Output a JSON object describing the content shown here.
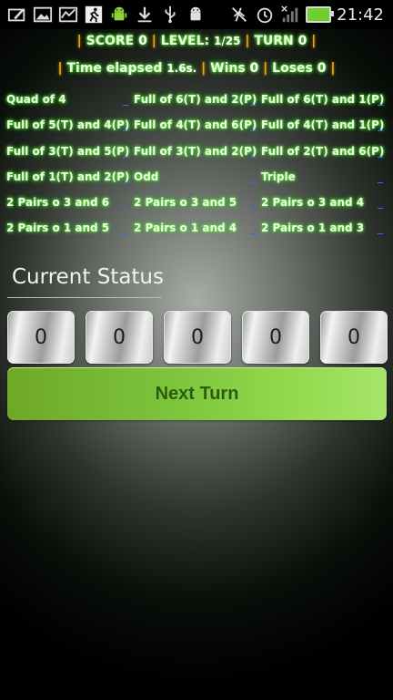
{
  "status_bar": {
    "time": "21:42",
    "left_icons": [
      "edit-icon",
      "image-icon",
      "chart-icon",
      "runner-icon",
      "android-icon",
      "download-icon",
      "usb-icon",
      "android-debug-icon"
    ],
    "right_icons": [
      "silent-icon",
      "alarm-icon",
      "signal-icon",
      "battery-icon"
    ]
  },
  "score_bar": {
    "score_label": "SCORE",
    "score_value": "0",
    "level_label": "LEVEL:",
    "level_value": "1/25",
    "turn_label": "TURN",
    "turn_value": "0",
    "time_label": "Time elapsed",
    "time_value": "1.6s.",
    "wins_label": "Wins",
    "wins_value": "0",
    "loses_label": "Loses",
    "loses_value": "0",
    "separator": "|"
  },
  "combos": [
    [
      "Quad of 4",
      "Full of 6(T) and 2(P)",
      "Full of 6(T) and 1(P)"
    ],
    [
      "Full of 5(T) and 4(P)",
      "Full of 4(T) and 6(P)",
      "Full of 4(T) and 1(P)"
    ],
    [
      "Full of 3(T) and 5(P)",
      "Full of 3(T) and 2(P)",
      "Full of 2(T) and 6(P)"
    ],
    [
      "Full of 1(T) and 2(P)",
      "Odd",
      "Triple"
    ],
    [
      "2 Pairs o 3 and 6",
      "2 Pairs o 3 and 5",
      "2 Pairs o 3 and 4"
    ],
    [
      "2 Pairs o 1 and 5",
      "2 Pairs o 1 and 4",
      "2 Pairs o 1 and 3"
    ]
  ],
  "current_status_label": "Current Status",
  "dice": [
    "0",
    "0",
    "0",
    "0",
    "0"
  ],
  "next_turn_label": "Next Turn",
  "colors": {
    "glow_green": "#6cff40",
    "separator_orange": "#d8b600",
    "button_green": "#7cc23a",
    "button_text": "#2d5b0c"
  }
}
